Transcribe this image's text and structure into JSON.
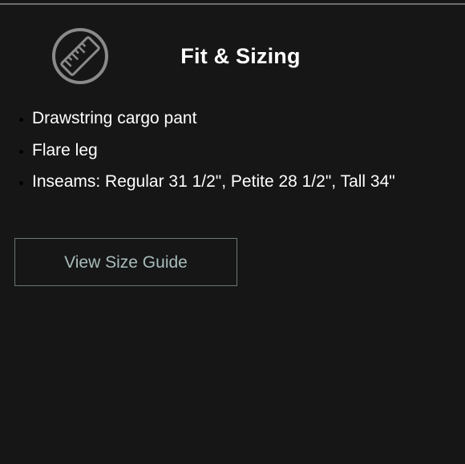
{
  "fit_sizing": {
    "icon": "ruler-icon",
    "title": "Fit & Sizing",
    "bullets": [
      "Drawstring cargo pant",
      "Flare leg",
      "Inseams: Regular 31 1/2\", Petite 28 1/2\", Tall 34\""
    ],
    "size_guide_button": "View Size Guide"
  },
  "colors": {
    "background": "#161616",
    "text": "#ffffff",
    "button_text": "#a9bcbb",
    "button_border": "#6d7777",
    "icon": "#8a8a8a"
  }
}
